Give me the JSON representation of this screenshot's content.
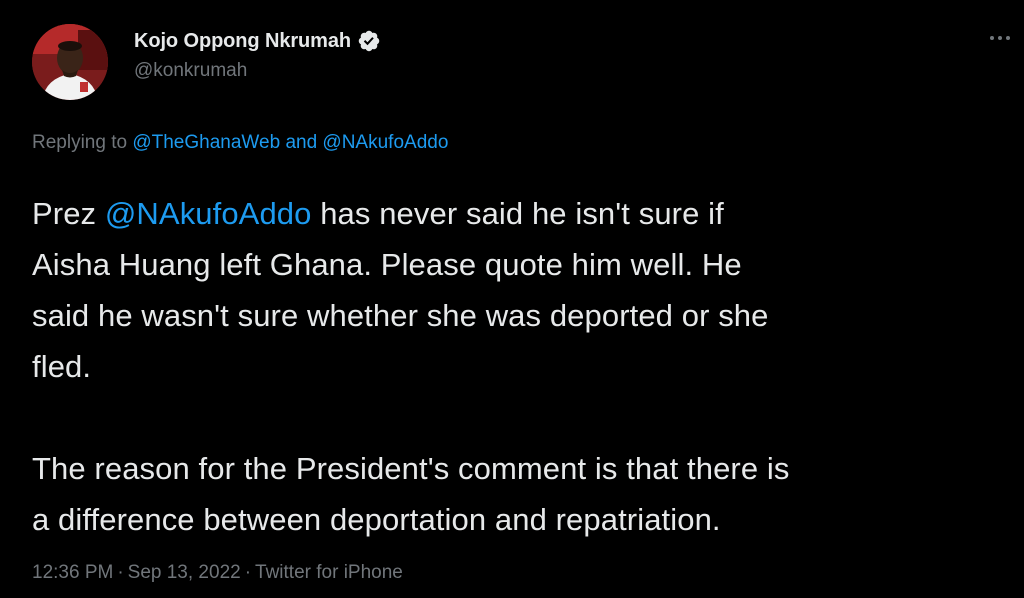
{
  "author": {
    "display_name": "Kojo Oppong Nkrumah",
    "handle": "@konkrumah",
    "verified": true,
    "verified_icon": "verified-badge-icon"
  },
  "more_icon": "more-options-icon",
  "replying": {
    "prefix": "Replying to",
    "mention1": "@TheGhanaWeb",
    "and": "and",
    "mention2": "@NAkufoAddo"
  },
  "tweet": {
    "line1_prefix": "Prez ",
    "line1_mention": "@NAkufoAddo",
    "line1_suffix": " has never said he isn't sure if",
    "line2": "Aisha Huang left Ghana. Please quote him well. He",
    "line3": "said he wasn't sure whether she was deported or she",
    "line4": "fled.",
    "line5": "The reason for the President's comment is that there is",
    "line6": "a difference between deportation and repatriation."
  },
  "meta": {
    "time": "12:36 PM",
    "date": "Sep 13, 2022",
    "source": "Twitter for iPhone",
    "separator": "·"
  },
  "colors": {
    "background": "#000000",
    "text": "#e7e9ea",
    "secondary": "#71767b",
    "link": "#1d9bf0"
  }
}
